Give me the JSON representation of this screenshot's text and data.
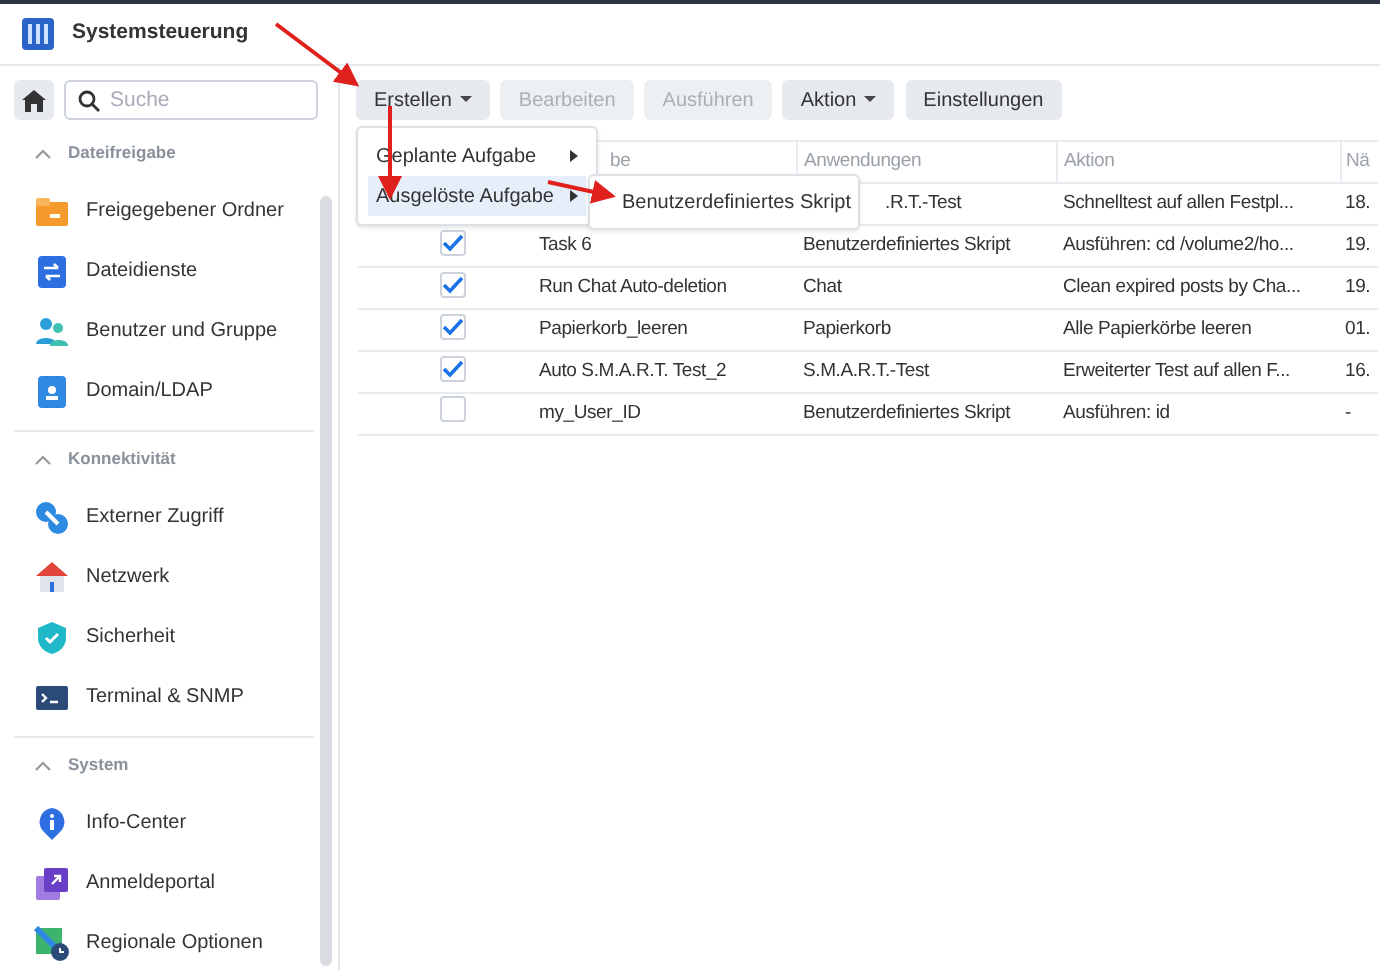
{
  "window": {
    "title": "Systemsteuerung"
  },
  "sidebar": {
    "search": {
      "placeholder": "Suche"
    },
    "sections": [
      {
        "title": "Dateifreigabe",
        "expanded": true,
        "items": [
          {
            "label": "Freigegebener Ordner"
          },
          {
            "label": "Dateidienste"
          },
          {
            "label": "Benutzer und Gruppe"
          },
          {
            "label": "Domain/LDAP"
          }
        ]
      },
      {
        "title": "Konnektivität",
        "expanded": true,
        "items": [
          {
            "label": "Externer Zugriff"
          },
          {
            "label": "Netzwerk"
          },
          {
            "label": "Sicherheit"
          },
          {
            "label": "Terminal & SNMP"
          }
        ]
      },
      {
        "title": "System",
        "expanded": true,
        "items": [
          {
            "label": "Info-Center"
          },
          {
            "label": "Anmeldeportal"
          },
          {
            "label": "Regionale Optionen"
          }
        ]
      }
    ]
  },
  "toolbar": {
    "buttons": [
      {
        "label": "Erstellen",
        "disabled": false,
        "dropdown": true
      },
      {
        "label": "Bearbeiten",
        "disabled": true,
        "dropdown": false
      },
      {
        "label": "Ausführen",
        "disabled": true,
        "dropdown": false
      },
      {
        "label": "Aktion",
        "disabled": false,
        "dropdown": true
      },
      {
        "label": "Einstellungen",
        "disabled": false,
        "dropdown": false
      }
    ]
  },
  "menu": {
    "items": [
      {
        "label": "Geplante Aufgabe",
        "selected": false,
        "submenu": true
      },
      {
        "label": "Ausgelöste Aufgabe",
        "selected": true,
        "submenu": true
      }
    ]
  },
  "submenu": {
    "items": [
      {
        "label": "Benutzerdefiniertes Skript"
      }
    ]
  },
  "table": {
    "columns": [
      {
        "label": "be",
        "cut": true
      },
      {
        "label": "Anwendungen"
      },
      {
        "label": "Aktion"
      },
      {
        "label": "Nä"
      }
    ],
    "rows": [
      {
        "app": ".R.T.-Test",
        "app_cut": true,
        "action": "Schnelltest auf allen Festpl...",
        "column_5": "18."
      },
      {
        "checked": true,
        "task": "Task 6",
        "app": "Benutzerdefiniertes Skript",
        "action": "Ausführen: cd /volume2/ho...",
        "column_5": "19."
      },
      {
        "checked": true,
        "task": "Run Chat Auto-deletion",
        "app": "Chat",
        "action": "Clean expired posts by Cha...",
        "column_5": "19."
      },
      {
        "checked": true,
        "task": "Papierkorb_leeren",
        "app": "Papierkorb",
        "action": "Alle Papierkörbe leeren",
        "column_5": "01."
      },
      {
        "checked": true,
        "task": "Auto S.M.A.R.T. Test_2",
        "app": "S.M.A.R.T.-Test",
        "action": "Erweiterter Test auf allen F...",
        "column_5": "16."
      },
      {
        "checked": false,
        "task": "my_User_ID",
        "app": "Benutzerdefiniertes Skript",
        "action": "Ausführen: id",
        "column_5": "-"
      }
    ]
  }
}
